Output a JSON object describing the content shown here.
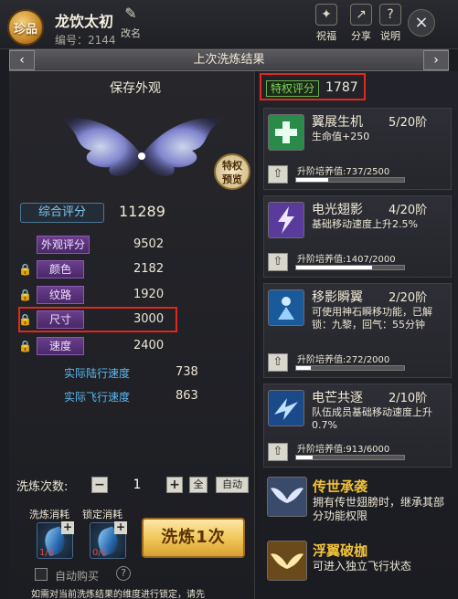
{
  "header": {
    "rarity_badge": "珍品",
    "wing_name": "龙饮太初",
    "serial": "编号：2144",
    "rename_label": "改名",
    "buttons": [
      {
        "label": "祝福",
        "icon": "blessing-icon"
      },
      {
        "label": "分享",
        "icon": "share-icon"
      },
      {
        "label": "说明",
        "icon": "help-icon"
      }
    ],
    "close": "×"
  },
  "title_bar": {
    "text": "上次洗炼结果",
    "prev": "‹",
    "next": "›"
  },
  "left": {
    "save_look": "保存外观",
    "vip_preview_line1": "特权",
    "vip_preview_line2": "预览",
    "total_score_label": "综合评分",
    "total_score_value": "11289",
    "attributes": [
      {
        "label": "外观评分",
        "value": "9502",
        "locked": false
      },
      {
        "label": "颜色",
        "value": "2182",
        "locked": true
      },
      {
        "label": "纹路",
        "value": "1920",
        "locked": true
      },
      {
        "label": "尺寸",
        "value": "3000",
        "locked": true
      },
      {
        "label": "速度",
        "value": "2400",
        "locked": true
      }
    ],
    "sub_stats": [
      {
        "label": "实际陆行速度",
        "value": "738"
      },
      {
        "label": "实际飞行速度",
        "value": "863"
      }
    ],
    "refine_times_label": "洗炼次数:",
    "minus": "−",
    "plus": "+",
    "refine_times_value": "1",
    "all_label": "全",
    "auto_label": "自动",
    "cost_labels": [
      "洗炼消耗",
      "锁定消耗"
    ],
    "costs": [
      "1/5",
      "0/0"
    ],
    "refine_button": "洗炼1次",
    "auto_buy_label": "自动购买",
    "help_mark": "?",
    "bottom_note": "如需对当前洗炼结果的维度进行锁定，请先"
  },
  "right": {
    "vip_score_label": "特权评分",
    "vip_score_value": "1787",
    "skills": [
      {
        "name": "翼展生机",
        "level": "5/20阶",
        "desc": "生命值+250",
        "train": "升阶培养值:737/2500",
        "progress": 0.295,
        "icon": "heal-plus-icon",
        "icon_bg": "#2a8a4a"
      },
      {
        "name": "电光翅影",
        "level": "4/20阶",
        "desc": "基础移动速度上升2.5%",
        "train": "升阶培养值:1407/2000",
        "progress": 0.7035,
        "icon": "lightning-wing-icon",
        "icon_bg": "#5a3a9a"
      },
      {
        "name": "移影瞬翼",
        "level": "2/20阶",
        "desc": "可使用神石瞬移功能，已解锁：九黎，回气：55分钟",
        "train": "升阶培养值:272/2000",
        "progress": 0.136,
        "icon": "teleport-icon",
        "icon_bg": "#1a5a9a"
      },
      {
        "name": "电芒共逐",
        "level": "2/10阶",
        "desc": "队伍成员基础移动速度上升0.7%",
        "train": "升阶培养值:913/6000",
        "progress": 0.152,
        "icon": "team-speed-icon",
        "icon_bg": "#1a4a8a"
      }
    ],
    "legends": [
      {
        "name": "传世承袭",
        "desc": "拥有传世翅膀时，继承其部分功能权限",
        "icon": "heritage-wing-icon",
        "icon_bg": "#3a4a6a"
      },
      {
        "name": "浮翼破枷",
        "desc": "可进入独立飞行状态",
        "icon": "free-flight-icon",
        "icon_bg": "#6a4a1a"
      }
    ]
  }
}
